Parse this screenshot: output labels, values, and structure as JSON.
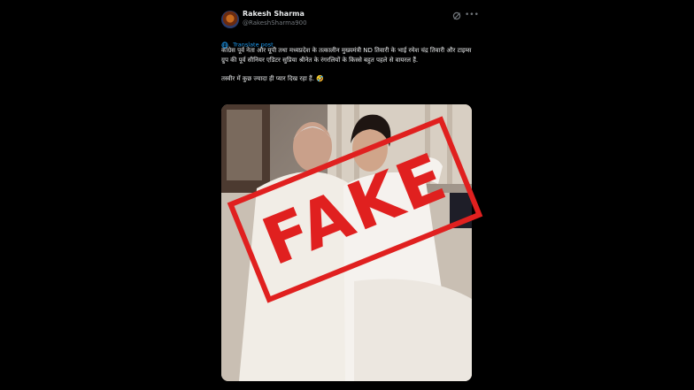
{
  "post": {
    "author_name": "Rakesh Sharma",
    "author_handle": "@RakeshSharma900",
    "translate_label": "Translate post",
    "text_line1": "कांग्रेस पूर्व नेता और यूपी तथा मध्यप्रदेश के तत्कालीन मुख्यमंत्री ND तिवारी के भाई रमेश चंद्र तिवारी और टाइम्स ग्रुप की पूर्व सीनियर एडिटर सुप्रिया श्रीनेत के रंगरलियों के किस्से बहुत पहले से वायरल हैं.",
    "text_line2": "तस्वीर में कुछ ज्यादा ही प्यार दिख रहा हैं. 🤣",
    "stamp_text": "FAKE",
    "icons": [
      "avatar",
      "grok-icon",
      "more-icon",
      "translate-icon"
    ],
    "colors": {
      "background": "#000000",
      "link": "#1d9bf0",
      "stamp": "#e0201f",
      "muted": "#71767b"
    }
  }
}
